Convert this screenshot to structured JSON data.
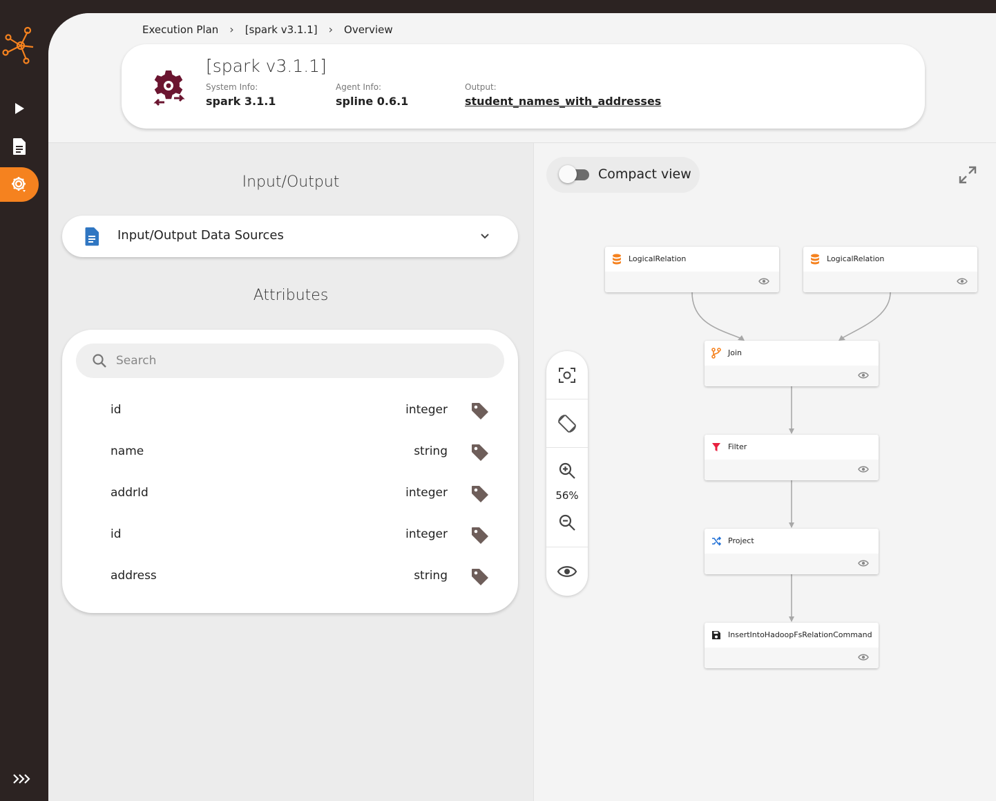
{
  "sidebar": {
    "items": [
      {
        "name": "play",
        "icon": "play-icon"
      },
      {
        "name": "document",
        "icon": "document-icon"
      },
      {
        "name": "execution-plan",
        "icon": "gear-icon",
        "active": true
      }
    ],
    "expand_icon": "double-chevron-right-icon"
  },
  "breadcrumb": {
    "items": [
      "Execution Plan",
      "[spark v3.1.1]",
      "Overview"
    ]
  },
  "header": {
    "title": "[spark v3.1.1]",
    "system_info_label": "System Info:",
    "system_info_value": "spark 3.1.1",
    "agent_info_label": "Agent Info:",
    "agent_info_value": "spline 0.6.1",
    "output_label": "Output:",
    "output_value": "student_names_with_addresses"
  },
  "left": {
    "io_title": "Input/Output",
    "io_accordion_label": "Input/Output Data Sources",
    "attributes_title": "Attributes",
    "search_placeholder": "Search",
    "attributes": [
      {
        "name": "id",
        "type": "integer"
      },
      {
        "name": "name",
        "type": "string"
      },
      {
        "name": "addrId",
        "type": "integer"
      },
      {
        "name": "id",
        "type": "integer"
      },
      {
        "name": "address",
        "type": "string"
      }
    ]
  },
  "right": {
    "compact_view_label": "Compact view",
    "compact_view_on": false,
    "zoom_level": "56%",
    "nodes": [
      {
        "id": "lr1",
        "label": "LogicalRelation",
        "icon": "database-icon",
        "color": "#f5821f"
      },
      {
        "id": "lr2",
        "label": "LogicalRelation",
        "icon": "database-icon",
        "color": "#f5821f"
      },
      {
        "id": "join",
        "label": "Join",
        "icon": "merge-icon",
        "color": "#f5821f"
      },
      {
        "id": "filter",
        "label": "Filter",
        "icon": "filter-icon",
        "color": "#e8213f"
      },
      {
        "id": "project",
        "label": "Project",
        "icon": "shuffle-icon",
        "color": "#1f6fd6"
      },
      {
        "id": "insert",
        "label": "InsertIntoHadoopFsRelationCommand",
        "icon": "save-icon",
        "color": "#222222"
      }
    ]
  },
  "colors": {
    "accent": "#f5821f",
    "sidebar_bg": "#2c2322",
    "plan_icon": "#6b1530",
    "tag_icon": "#6e5e5a"
  }
}
